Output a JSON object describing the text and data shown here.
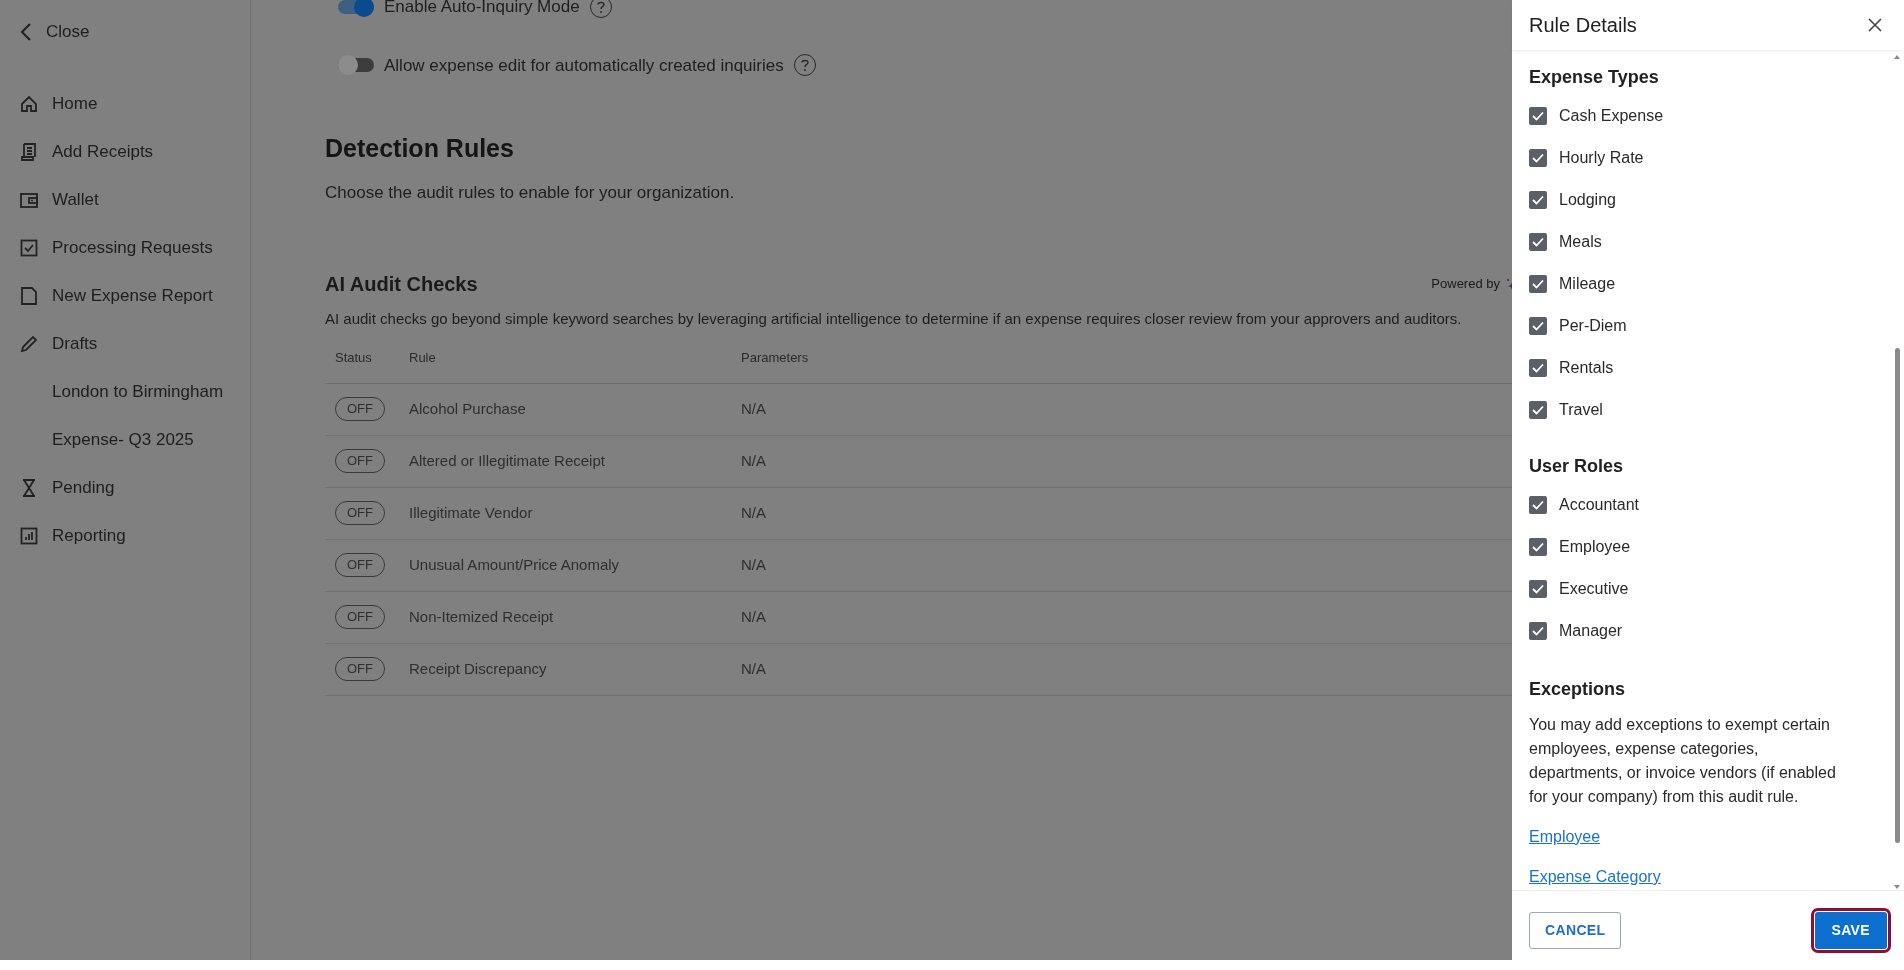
{
  "sidebar": {
    "close": "Close",
    "items": [
      {
        "label": "Home"
      },
      {
        "label": "Add Receipts"
      },
      {
        "label": "Wallet"
      },
      {
        "label": "Processing Requests"
      },
      {
        "label": "New Expense Report"
      },
      {
        "label": "Drafts",
        "children": [
          {
            "label": "London to Birmingham"
          },
          {
            "label": "Expense- Q3 2025"
          }
        ]
      },
      {
        "label": "Pending"
      },
      {
        "label": "Reporting"
      }
    ]
  },
  "settings": [
    {
      "label": "Enable Auto-Inquiry Mode",
      "on": true
    },
    {
      "label": "Allow expense edit for automatically created inquiries",
      "on": false
    }
  ],
  "detection": {
    "title": "Detection Rules",
    "subtitle": "Choose the audit rules to enable for your organization."
  },
  "ai_checks": {
    "title": "AI Audit Checks",
    "powered_by": "Powered by",
    "description": "AI audit checks go beyond simple keyword searches by leveraging artificial intelligence to determine if an expense requires closer review from your approvers and auditors.",
    "table": {
      "columns": [
        "Status",
        "Rule",
        "Parameters"
      ],
      "rows": [
        {
          "status": "OFF",
          "rule": "Alcohol Purchase",
          "parameters": "N/A"
        },
        {
          "status": "OFF",
          "rule": "Altered or Illegitimate Receipt",
          "parameters": "N/A"
        },
        {
          "status": "OFF",
          "rule": "Illegitimate Vendor",
          "parameters": "N/A"
        },
        {
          "status": "OFF",
          "rule": "Unusual Amount/Price Anomaly",
          "parameters": "N/A"
        },
        {
          "status": "OFF",
          "rule": "Non-Itemized Receipt",
          "parameters": "N/A"
        },
        {
          "status": "OFF",
          "rule": "Receipt Discrepancy",
          "parameters": "N/A"
        }
      ]
    }
  },
  "panel": {
    "title": "Rule Details",
    "sections": [
      {
        "heading": "Expense Types",
        "options": [
          {
            "label": "Cash Expense",
            "checked": true
          },
          {
            "label": "Hourly Rate",
            "checked": true
          },
          {
            "label": "Lodging",
            "checked": true
          },
          {
            "label": "Meals",
            "checked": true
          },
          {
            "label": "Mileage",
            "checked": true
          },
          {
            "label": "Per-Diem",
            "checked": true
          },
          {
            "label": "Rentals",
            "checked": true
          },
          {
            "label": "Travel",
            "checked": true
          }
        ]
      },
      {
        "heading": "User Roles",
        "options": [
          {
            "label": "Accountant",
            "checked": true
          },
          {
            "label": "Employee",
            "checked": true
          },
          {
            "label": "Executive",
            "checked": true
          },
          {
            "label": "Manager",
            "checked": true
          }
        ]
      }
    ],
    "exceptions": {
      "heading": "Exceptions",
      "text": "You may add exceptions to exempt certain employees, expense categories, departments, or invoice vendors (if enabled for your company) from this audit rule.",
      "links": [
        "Employee",
        "Expense Category"
      ]
    },
    "buttons": {
      "cancel": "CANCEL",
      "save": "SAVE"
    }
  }
}
